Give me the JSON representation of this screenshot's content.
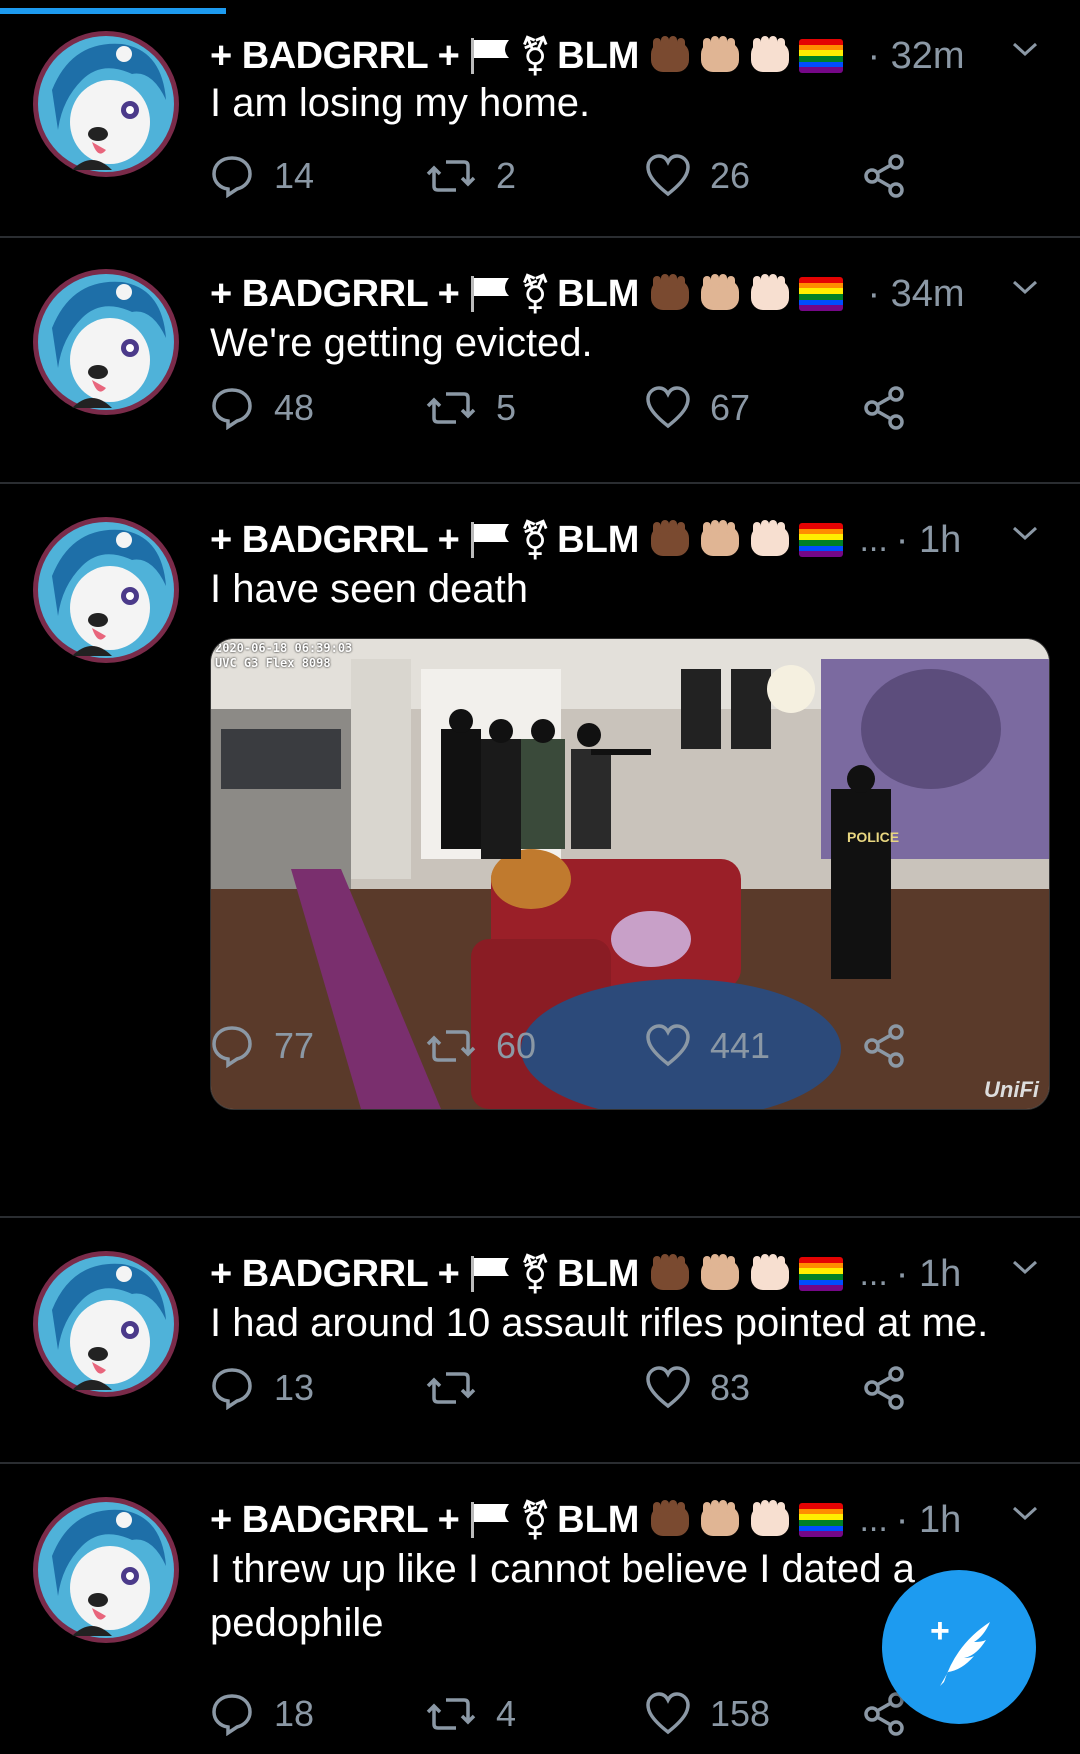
{
  "colors": {
    "accent": "#1d9bf0",
    "muted": "#8b98a5",
    "background": "#000000"
  },
  "author": {
    "display_name": "+ BADGRRL +",
    "gender_symbol": "⚧",
    "blm_text": "BLM",
    "flag_icon": "white-flag-icon",
    "fist_icons": [
      "fist-dark-icon",
      "fist-medium-icon",
      "fist-light-icon"
    ],
    "rainbow_icon": "rainbow-flag-icon"
  },
  "tweets": [
    {
      "ellipsis": "",
      "time": "· 32m",
      "text": "I am losing my home.",
      "replies": "14",
      "retweets": "2",
      "likes": "26"
    },
    {
      "ellipsis": "",
      "time": "· 34m",
      "text": "We're getting evicted.",
      "replies": "48",
      "retweets": "5",
      "likes": "67"
    },
    {
      "ellipsis": "...",
      "time": "· 1h",
      "text": "I have seen death",
      "replies": "77",
      "retweets": "60",
      "likes": "441",
      "media": {
        "timestamp": "2020-06-18 06:39:03",
        "camera": "UVC G3 Flex 8098",
        "watermark": "UniFi",
        "vest_text": "POLICE"
      }
    },
    {
      "ellipsis": "...",
      "time": "· 1h",
      "text": "I had around 10 assault rifles pointed at me.",
      "replies": "13",
      "retweets": "",
      "likes": "83"
    },
    {
      "ellipsis": "...",
      "time": "· 1h",
      "text": "I threw up like I cannot believe I dated a pedophile",
      "replies": "18",
      "retweets": "4",
      "likes": "158"
    }
  ],
  "compose_button": {
    "icon": "compose-feather-icon",
    "plus": "+"
  }
}
